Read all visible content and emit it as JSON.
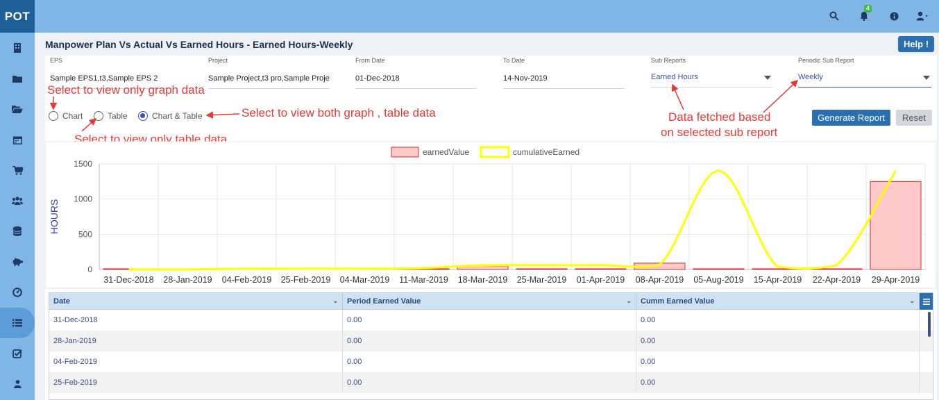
{
  "app": {
    "logo": "POT",
    "notification_count": "4"
  },
  "page": {
    "title": "Manpower Plan Vs Actual Vs Earned Hours - Earned Hours-Weekly",
    "help_label": "Help !"
  },
  "filters": {
    "eps": {
      "label": "EPS",
      "value": "Sample EPS1,t3,Sample EPS 2"
    },
    "project": {
      "label": "Project",
      "value": "Sample Project,t3 pro,Sample Proje"
    },
    "from_date": {
      "label": "From Date",
      "value": "01-Dec-2018"
    },
    "to_date": {
      "label": "To Date",
      "value": "14-Nov-2019"
    },
    "sub_reports": {
      "label": "Sub Reports",
      "value": "Earned Hours"
    },
    "periodic_sub_report": {
      "label": "Periodic Sub Report",
      "value": "Weekly"
    }
  },
  "view_options": {
    "chart": "Chart",
    "table": "Table",
    "chart_table": "Chart & Table",
    "selected": "Chart & Table"
  },
  "buttons": {
    "generate": "Generate Report",
    "reset": "Reset"
  },
  "annotations": {
    "graph_only": "Select to view only graph data",
    "both": "Select to view both graph , table data",
    "table_only": "Select to view only table data",
    "fetched_1": "Data fetched based",
    "fetched_2": "on selected sub report"
  },
  "colors": {
    "accent": "#2a6fb0",
    "bar_fill": "#ffc9c9",
    "bar_stroke": "#d32f2f",
    "line": "#ffff00",
    "annotation": "#e53935"
  },
  "chart_data": {
    "type": "bar",
    "categories": [
      "31-Dec-2018",
      "28-Jan-2019",
      "04-Feb-2019",
      "25-Feb-2019",
      "04-Mar-2019",
      "11-Mar-2019",
      "18-Mar-2019",
      "25-Mar-2019",
      "01-Apr-2019",
      "08-Apr-2019",
      "05-Aug-2019",
      "15-Apr-2019",
      "22-Apr-2019",
      "29-Apr-2019"
    ],
    "series": [
      {
        "name": "earnedValue",
        "type": "bar",
        "values": [
          0,
          0,
          0,
          0,
          0,
          10,
          50,
          5,
          5,
          90,
          0,
          0,
          0,
          1250
        ]
      },
      {
        "name": "cumulativeEarned",
        "type": "line",
        "values": [
          0,
          0,
          10,
          10,
          10,
          20,
          60,
          60,
          60,
          70,
          1400,
          40,
          60,
          1400
        ]
      }
    ],
    "ylabel": "HOURS",
    "yticks": [
      0,
      500,
      1000,
      1500
    ],
    "ylim": [
      0,
      1500
    ],
    "grid": true,
    "legend": "top-center"
  },
  "table": {
    "columns": [
      "Date",
      "Period Earned Value",
      "Cumm Earned Value"
    ],
    "rows": [
      [
        "31-Dec-2018",
        "0.00",
        "0.00"
      ],
      [
        "28-Jan-2019",
        "0.00",
        "0.00"
      ],
      [
        "04-Feb-2019",
        "0.00",
        "0.00"
      ],
      [
        "25-Feb-2019",
        "0.00",
        "0.00"
      ]
    ]
  }
}
